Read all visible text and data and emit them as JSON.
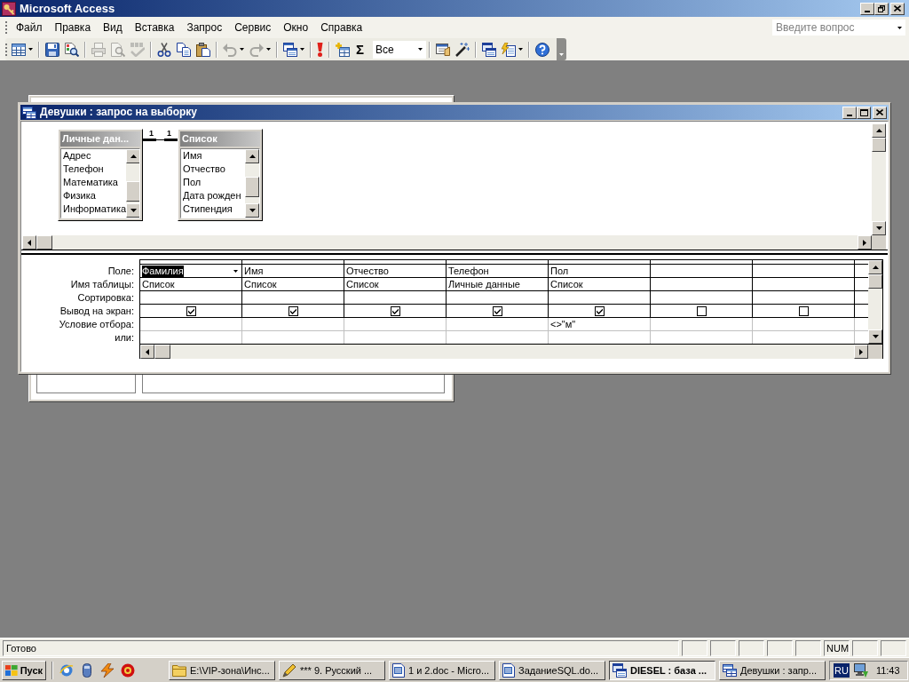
{
  "app_window": {
    "title": "Microsoft Access"
  },
  "menu": [
    "Файл",
    "Правка",
    "Вид",
    "Вставка",
    "Запрос",
    "Сервис",
    "Окно",
    "Справка"
  ],
  "help_box": {
    "placeholder": "Введите вопрос"
  },
  "toolbar": [
    [
      {
        "kind": "button",
        "disabled": false,
        "dropdown": true
      }
    ],
    [
      {
        "kind": "button",
        "disabled": false,
        "dropdown": false
      },
      {
        "kind": "button",
        "disabled": false,
        "dropdown": false
      }
    ],
    [
      {
        "kind": "button",
        "disabled": true,
        "dropdown": false
      },
      {
        "kind": "button",
        "disabled": true,
        "dropdown": false
      },
      {
        "kind": "button",
        "disabled": true,
        "dropdown": false
      }
    ],
    [
      {
        "kind": "button",
        "disabled": false,
        "dropdown": false
      },
      {
        "kind": "button",
        "disabled": false,
        "dropdown": false
      },
      {
        "kind": "button",
        "disabled": false,
        "dropdown": false
      }
    ],
    [
      {
        "kind": "button",
        "disabled": true,
        "dropdown": true
      },
      {
        "kind": "button",
        "disabled": true,
        "dropdown": true
      }
    ],
    [
      {
        "kind": "button",
        "disabled": false,
        "dropdown": true
      }
    ],
    [
      {
        "kind": "button",
        "disabled": false,
        "dropdown": false
      }
    ],
    [
      {
        "kind": "button",
        "disabled": false,
        "dropdown": false
      },
      {
        "kind": "glyph",
        "text": "Σ",
        "disabled": false
      },
      {
        "kind": "combo",
        "value": "Все"
      }
    ],
    [
      {
        "kind": "button",
        "disabled": false,
        "dropdown": false
      },
      {
        "kind": "button",
        "disabled": false,
        "dropdown": false
      }
    ],
    [
      {
        "kind": "button",
        "disabled": false,
        "dropdown": false
      },
      {
        "kind": "button",
        "disabled": false,
        "dropdown": true
      }
    ],
    [
      {
        "kind": "button",
        "disabled": false,
        "dropdown": false
      }
    ]
  ],
  "query_window": {
    "title": "Девушки : запрос на выборку",
    "tables": [
      {
        "title": "Личные дан...",
        "fields": [
          "Адрес",
          "Телефон",
          "Математика",
          "Физика",
          "Информатика"
        ]
      },
      {
        "title": "Список",
        "fields": [
          "Имя",
          "Отчество",
          "Пол",
          "Дата рожден",
          "Стипендия"
        ]
      }
    ],
    "relationship": {
      "left_label": "1",
      "right_label": "1"
    },
    "grid": {
      "row_labels": [
        "Поле:",
        "Имя таблицы:",
        "Сортировка:",
        "Вывод на экран:",
        "Условие отбора:",
        "или:"
      ],
      "columns": [
        {
          "field": "Фамилия",
          "table": "Список",
          "show": true,
          "selected": true
        },
        {
          "field": "Имя",
          "table": "Список",
          "show": true,
          "selected": false
        },
        {
          "field": "Отчество",
          "table": "Список",
          "show": true,
          "selected": false
        },
        {
          "field": "Телефон",
          "table": "Личные данные",
          "show": true,
          "selected": false
        },
        {
          "field": "Пол",
          "table": "Список",
          "show": true,
          "criteria": "<>\"м\"",
          "selected": false
        },
        {
          "show": false,
          "selected": false
        },
        {
          "show": false,
          "selected": false
        }
      ]
    }
  },
  "status_bar": {
    "message": "Готово",
    "indicator": "NUM"
  },
  "taskbar": {
    "start_label": "Пуск",
    "tasks": [
      {
        "kind": "folder",
        "label": "E:\\VIP-зона\\Инс...",
        "selected": false
      },
      {
        "kind": "program",
        "label": "*** 9. Русский ...",
        "selected": false
      },
      {
        "kind": "document",
        "label": "1 и 2.doc - Micro...",
        "selected": false
      },
      {
        "kind": "document",
        "label": "ЗаданиеSQL.do...",
        "selected": false
      },
      {
        "kind": "database",
        "label": "DIESEL : база ...",
        "selected": true
      },
      {
        "kind": "query",
        "label": "Девушки : запр...",
        "selected": false
      }
    ],
    "tray": {
      "language": "RU",
      "clock": "11:43"
    }
  }
}
